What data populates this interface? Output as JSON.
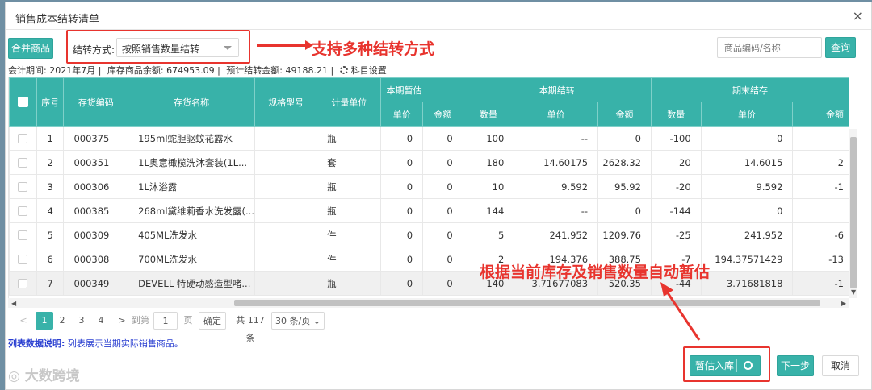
{
  "dialog": {
    "title": "销售成本结转清单",
    "close": "×"
  },
  "toolbar": {
    "merge_label": "合并商品",
    "method_label": "结转方式:",
    "method_value": "按照销售数量结转",
    "annotation_methods": "支持多种结转方式",
    "search_placeholder": "商品编码/名称",
    "search_label": "查询"
  },
  "info": {
    "period": "会计期间: 2021年7月 |",
    "stock": "库存商品余额: 674953.09 |",
    "estimate": "预计结转金额: 49188.21 |",
    "subject_settings": "科目设置"
  },
  "table": {
    "headers": {
      "seq": "序号",
      "code": "存货编码",
      "name": "存货名称",
      "spec": "规格型号",
      "unit": "计量单位",
      "group_temp": "本期暂估",
      "group_transfer": "本期结转",
      "group_ending": "期末结存",
      "price": "单价",
      "amount": "金额",
      "qty": "数量"
    },
    "rows": [
      {
        "seq": "1",
        "code": "000375",
        "name": "195ml蛇胆驱蚊花露水",
        "spec": "",
        "unit": "瓶",
        "tp": "0",
        "ta": "0",
        "cq": "100",
        "cp": "--",
        "ca": "0",
        "eq": "-100",
        "ep": "0",
        "ea": ""
      },
      {
        "seq": "2",
        "code": "000351",
        "name": "1L奥意橄榄洗沐套装(1L...",
        "spec": "",
        "unit": "套",
        "tp": "0",
        "ta": "0",
        "cq": "180",
        "cp": "14.60175",
        "ca": "2628.32",
        "eq": "20",
        "ep": "14.6015",
        "ea": "2"
      },
      {
        "seq": "3",
        "code": "000306",
        "name": "1L沐浴露",
        "spec": "",
        "unit": "瓶",
        "tp": "0",
        "ta": "0",
        "cq": "10",
        "cp": "9.592",
        "ca": "95.92",
        "eq": "-20",
        "ep": "9.592",
        "ea": "-1"
      },
      {
        "seq": "4",
        "code": "000385",
        "name": "268ml黛维莉香水洗发露(...",
        "spec": "",
        "unit": "瓶",
        "tp": "0",
        "ta": "0",
        "cq": "144",
        "cp": "--",
        "ca": "0",
        "eq": "-144",
        "ep": "0",
        "ea": ""
      },
      {
        "seq": "5",
        "code": "000309",
        "name": "405ML洗发水",
        "spec": "",
        "unit": "件",
        "tp": "0",
        "ta": "0",
        "cq": "5",
        "cp": "241.952",
        "ca": "1209.76",
        "eq": "-25",
        "ep": "241.952",
        "ea": "-6"
      },
      {
        "seq": "6",
        "code": "000308",
        "name": "700ML洗发水",
        "spec": "",
        "unit": "件",
        "tp": "0",
        "ta": "0",
        "cq": "2",
        "cp": "194.376",
        "ca": "388.75",
        "eq": "-7",
        "ep": "194.37571429",
        "ea": "-13"
      },
      {
        "seq": "7",
        "code": "000349",
        "name": "DEVELL 特硬动感造型啫...",
        "spec": "",
        "unit": "瓶",
        "tp": "0",
        "ta": "0",
        "cq": "140",
        "cp": "3.71677083",
        "ca": "520.35",
        "eq": "-44",
        "ep": "3.71681818",
        "ea": "-1"
      }
    ]
  },
  "annotation_auto": "根据当前库存及销售数量自动暂估",
  "pagination": {
    "prev": "<",
    "next": ">",
    "pages": [
      "1",
      "2",
      "3",
      "4"
    ],
    "goto_label": "到第",
    "goto_value": "1",
    "page_unit": "页",
    "confirm": "确定",
    "total": "共 117 条",
    "page_size": "30 条/页"
  },
  "note": {
    "label": "列表数据说明:",
    "text": "列表展示当期实际销售商品。"
  },
  "watermark": "大数跨境",
  "footer": {
    "temp_label": "暂估入库",
    "next_label": "下一步",
    "cancel_label": "取消"
  },
  "colors": {
    "accent": "#38b2a9",
    "annotation": "#e8342e",
    "note": "#2a3fd1"
  }
}
